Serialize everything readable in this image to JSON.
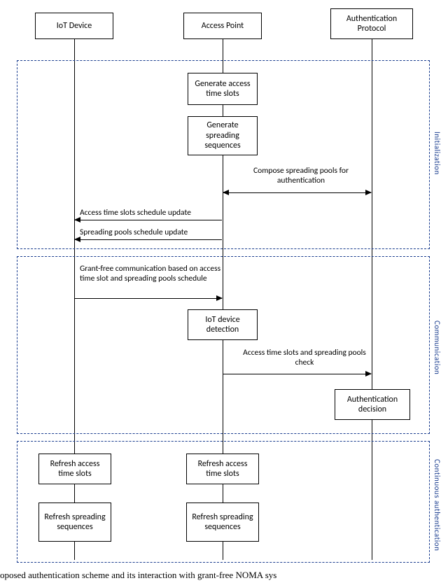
{
  "actors": {
    "iot": "IoT Device",
    "ap": "Access Point",
    "auth": "Authentication Protocol"
  },
  "phases": {
    "init": "Initialization",
    "comm": "Communication",
    "cont": "Continuous authentication"
  },
  "steps": {
    "gen_slots": "Generate access time slots",
    "gen_seq": "Generate spreading sequences",
    "iot_detect": "IoT device detection",
    "auth_decision": "Authentication decision",
    "refresh_slots": "Refresh access time slots",
    "refresh_seq": "Refresh spreading sequences"
  },
  "messages": {
    "compose": "Compose spreading pools for authentication",
    "slots_update": "Access time slots schedule update",
    "pools_update": "Spreading pools schedule update",
    "grant_free": "Grant-free communication based on access time slot and spreading pools schedule",
    "pools_check": "Access time slots and spreading pools check"
  },
  "caption": "oposed authentication scheme and its interaction with grant-free NOMA sys"
}
